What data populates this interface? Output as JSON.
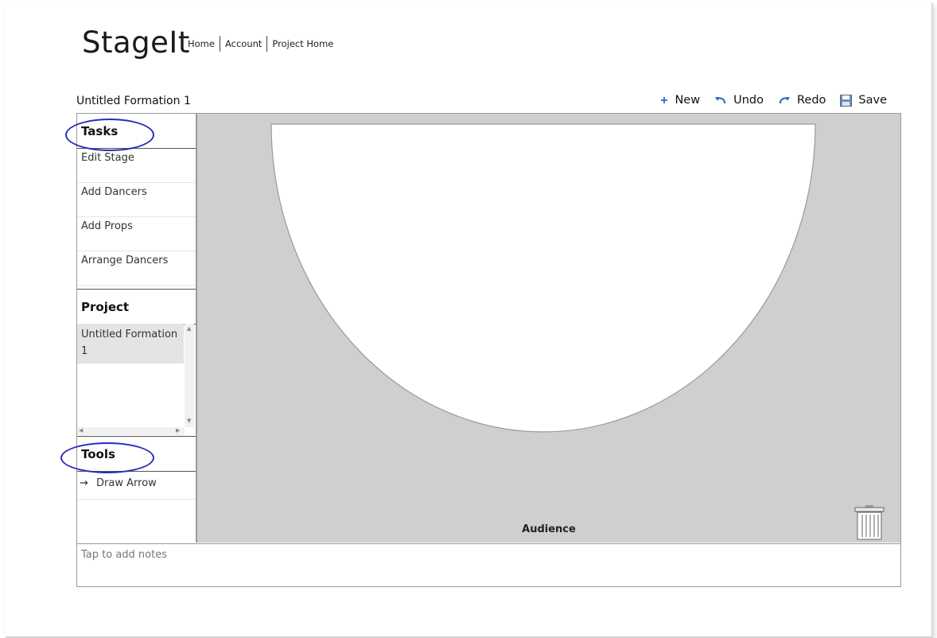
{
  "app": {
    "logo": "StageIt",
    "nav": [
      "Home",
      "Account",
      "Project Home"
    ]
  },
  "formation_title": "Untitled Formation 1",
  "toolbar": {
    "new_label": "New",
    "undo_label": "Undo",
    "redo_label": "Redo",
    "save_label": "Save"
  },
  "sidebar": {
    "tasks_header": "Tasks",
    "tasks": [
      "Edit Stage",
      "Add Dancers",
      "Add Props",
      "Arrange Dancers"
    ],
    "project_header": "Project",
    "projects": [
      "Untitled Formation 1"
    ],
    "tools_header": "Tools",
    "tools": [
      {
        "label": "Draw Arrow",
        "icon": "right-arrow-icon"
      }
    ]
  },
  "stage": {
    "audience_label": "Audience",
    "stage_color": "#ffffff",
    "background_color": "#cfcfcf"
  },
  "notes": {
    "placeholder": "Tap to add notes"
  },
  "annotation_color": "#2b2bbf"
}
